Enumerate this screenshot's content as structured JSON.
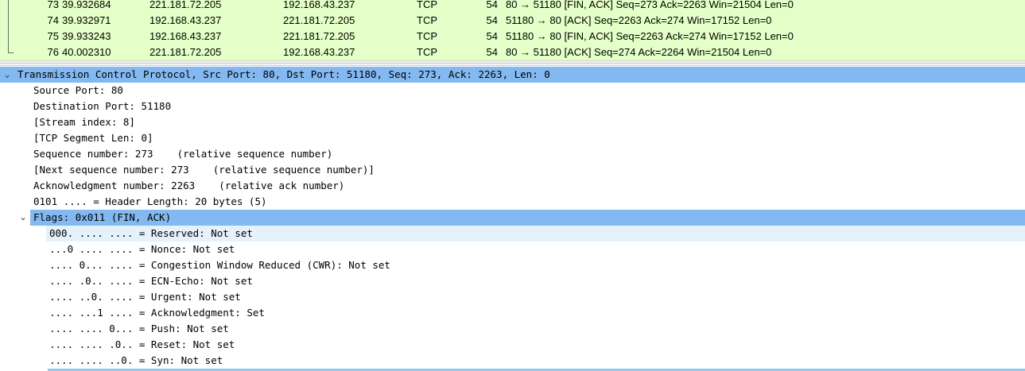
{
  "packets": [
    {
      "no": "73",
      "time": "39.932684",
      "src": "221.181.72.205",
      "dst": "192.168.43.237",
      "proto": "TCP",
      "len": "54",
      "info": "80 → 51180 [FIN, ACK] Seq=273 Ack=2263 Win=21504 Len=0"
    },
    {
      "no": "74",
      "time": "39.932971",
      "src": "192.168.43.237",
      "dst": "221.181.72.205",
      "proto": "TCP",
      "len": "54",
      "info": "51180 → 80 [ACK] Seq=2263 Ack=274 Win=17152 Len=0"
    },
    {
      "no": "75",
      "time": "39.933243",
      "src": "192.168.43.237",
      "dst": "221.181.72.205",
      "proto": "TCP",
      "len": "54",
      "info": "51180 → 80 [FIN, ACK] Seq=2263 Ack=274 Win=17152 Len=0"
    },
    {
      "no": "76",
      "time": "40.002310",
      "src": "221.181.72.205",
      "dst": "192.168.43.237",
      "proto": "TCP",
      "len": "54",
      "info": "80 → 51180 [ACK] Seq=274 Ack=2264 Win=21504 Len=0"
    }
  ],
  "details": {
    "tcp_header": "Transmission Control Protocol, Src Port: 80, Dst Port: 51180, Seq: 273, Ack: 2263, Len: 0",
    "fields": [
      "Source Port: 80",
      "Destination Port: 51180",
      "[Stream index: 8]",
      "[TCP Segment Len: 0]",
      "Sequence number: 273    (relative sequence number)",
      "[Next sequence number: 273    (relative sequence number)]",
      "Acknowledgment number: 2263    (relative ack number)",
      "0101 .... = Header Length: 20 bytes (5)"
    ],
    "flags_header": "Flags: 0x011 (FIN, ACK)",
    "flags": [
      "000. .... .... = Reserved: Not set",
      "...0 .... .... = Nonce: Not set",
      ".... 0... .... = Congestion Window Reduced (CWR): Not set",
      ".... .0.. .... = ECN-Echo: Not set",
      ".... ..0. .... = Urgent: Not set",
      ".... ...1 .... = Acknowledgment: Set",
      ".... .... 0... = Push: Not set",
      ".... .... .0.. = Reset: Not set",
      ".... .... ..0. = Syn: Not set"
    ]
  },
  "colors": {
    "packet_row_bg": "#e4ffc7",
    "selected_bg": "#83b8f0",
    "hover_bg": "#e5f1fb"
  },
  "icons": {
    "expanded": "chevron-down-icon"
  }
}
